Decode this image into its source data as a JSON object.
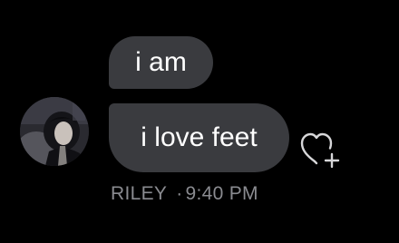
{
  "messages": [
    {
      "text": "i am"
    },
    {
      "text": "i love feet"
    }
  ],
  "sender": {
    "name": "RILEY",
    "separator": "·",
    "time": "9:40 PM"
  },
  "icons": {
    "avatar": "profile-photo",
    "reaction": "heart-plus-icon"
  },
  "colors": {
    "background": "#000000",
    "bubble": "#3a3b3f",
    "text": "#ffffff",
    "meta": "#8a8b90",
    "icon_stroke": "#d6d6d8"
  }
}
